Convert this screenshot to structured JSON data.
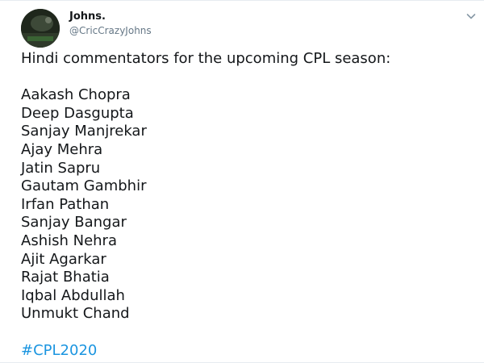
{
  "author": {
    "display_name": "Johns.",
    "handle": "@CricCrazyJohns"
  },
  "menu": {
    "icon": "chevron-down-icon"
  },
  "tweet": {
    "intro": "Hindi commentators for the upcoming CPL season:",
    "commentators": [
      "Aakash Chopra",
      "Deep Dasgupta",
      "Sanjay Manjrekar",
      "Ajay Mehra",
      "Jatin Sapru",
      "Gautam Gambhir",
      "Irfan Pathan",
      "Sanjay Bangar",
      "Ashish Nehra",
      "Ajit Agarkar",
      "Rajat Bhatia",
      "Iqbal Abdullah",
      "Unmukt Chand"
    ],
    "hashtag": "#CPL2020"
  },
  "colors": {
    "text": "#14171a",
    "secondary_text": "#657786",
    "link": "#1b95e0",
    "divider": "#e6ecf0"
  }
}
